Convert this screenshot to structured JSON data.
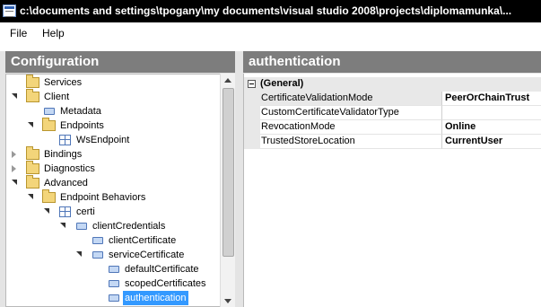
{
  "window": {
    "title": "c:\\documents and settings\\tpogany\\my documents\\visual studio 2008\\projects\\diplomamunka\\..."
  },
  "menu": {
    "file": "File",
    "help": "Help"
  },
  "config_pane": {
    "title": "Configuration",
    "tree": [
      {
        "label": "Services",
        "icon": "folder-icon",
        "expander": "none"
      },
      {
        "label": "Client",
        "icon": "folder-icon",
        "expander": "open"
      },
      {
        "label": "Metadata",
        "icon": "item-icon",
        "expander": "none"
      },
      {
        "label": "Endpoints",
        "icon": "folder-icon",
        "expander": "open"
      },
      {
        "label": "WsEndpoint",
        "icon": "endpoint-icon",
        "expander": "none"
      },
      {
        "label": "Bindings",
        "icon": "folder-icon",
        "expander": "closed"
      },
      {
        "label": "Diagnostics",
        "icon": "folder-icon",
        "expander": "closed"
      },
      {
        "label": "Advanced",
        "icon": "folder-icon",
        "expander": "open"
      },
      {
        "label": "Endpoint Behaviors",
        "icon": "folder-icon",
        "expander": "open"
      },
      {
        "label": "certi",
        "icon": "behavior-icon",
        "expander": "open"
      },
      {
        "label": "clientCredentials",
        "icon": "item-icon",
        "expander": "open"
      },
      {
        "label": "clientCertificate",
        "icon": "item-icon",
        "expander": "none"
      },
      {
        "label": "serviceCertificate",
        "icon": "item-icon",
        "expander": "open"
      },
      {
        "label": "defaultCertificate",
        "icon": "item-icon",
        "expander": "none"
      },
      {
        "label": "scopedCertificates",
        "icon": "item-icon",
        "expander": "none"
      },
      {
        "label": "authentication",
        "icon": "item-icon",
        "expander": "none",
        "selected": true
      }
    ]
  },
  "props_pane": {
    "title": "authentication",
    "category": "(General)",
    "rows": [
      {
        "name": "CertificateValidationMode",
        "value": "PeerOrChainTrust"
      },
      {
        "name": "CustomCertificateValidatorType",
        "value": ""
      },
      {
        "name": "RevocationMode",
        "value": "Online"
      },
      {
        "name": "TrustedStoreLocation",
        "value": "CurrentUser"
      }
    ]
  },
  "colors": {
    "selection": "#3399ff",
    "pane_header": "#7d7d7d",
    "title_bar": "#000000"
  }
}
